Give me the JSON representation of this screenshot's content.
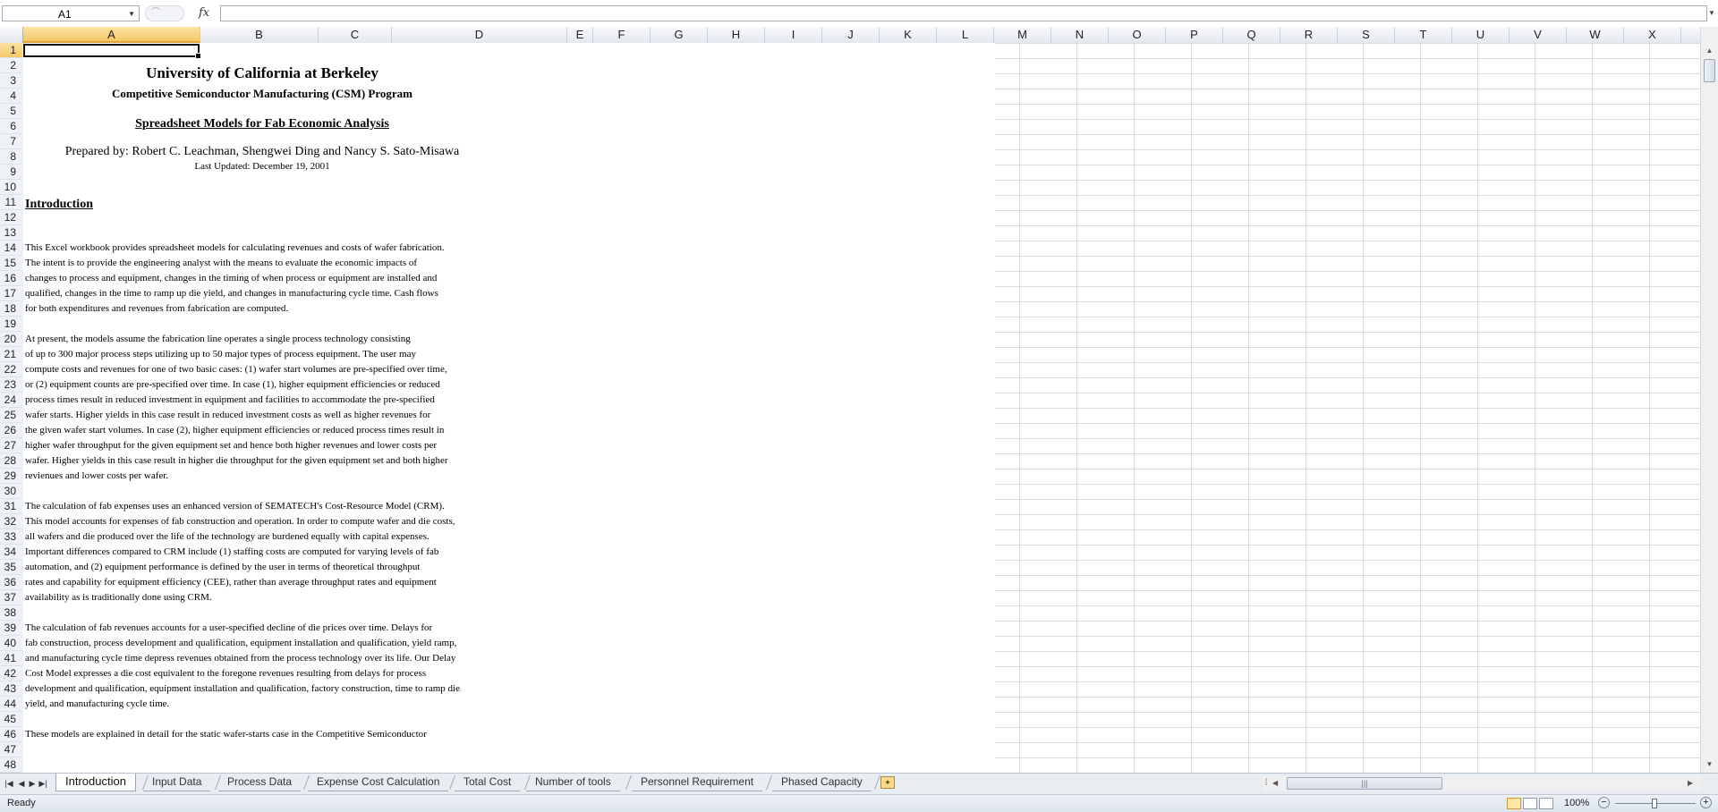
{
  "formula_bar": {
    "name_box": "A1",
    "fx_label": "fx",
    "formula_value": ""
  },
  "columns": [
    "A",
    "B",
    "C",
    "D",
    "E",
    "F",
    "G",
    "H",
    "I",
    "J",
    "K",
    "L",
    "M",
    "N",
    "O",
    "P",
    "Q",
    "R",
    "S",
    "T",
    "U",
    "V",
    "W",
    "X"
  ],
  "rows": [
    "1",
    "2",
    "3",
    "4",
    "5",
    "6",
    "7",
    "8",
    "9",
    "10",
    "11",
    "12",
    "13",
    "14",
    "15",
    "16",
    "17",
    "18",
    "19",
    "20",
    "21",
    "22",
    "23",
    "24",
    "25",
    "26",
    "27",
    "28",
    "29",
    "30",
    "31",
    "32",
    "33",
    "34",
    "35",
    "36",
    "37",
    "38",
    "39",
    "40",
    "41",
    "42",
    "43",
    "44",
    "45",
    "46",
    "47",
    "48"
  ],
  "cells": {
    "title": "University of California at Berkeley",
    "program": "Competitive Semiconductor Manufacturing (CSM) Program",
    "subtitle": "Spreadsheet Models for Fab Economic Analysis",
    "prepared_by": "Prepared by: Robert C. Leachman, Shengwei Ding and Nancy S. Sato-Misawa",
    "last_updated": "Last Updated: December 19, 2001",
    "heading": "Introduction",
    "lines": {
      "r14": "       This Excel workbook provides spreadsheet models for calculating revenues and costs of wafer fabrication.",
      "r15": "The intent is to provide the engineering analyst with the means to evaluate the economic impacts of",
      "r16": "changes to process and equipment, changes in the timing of when process or equipment are installed and",
      "r17": "qualified, changes in the time to ramp up die yield, and changes in manufacturing cycle time. Cash flows",
      "r18": "for both expenditures and revenues from fabrication are computed.",
      "r20": "       At present, the models assume the fabrication line operates a single process technology consisting",
      "r21": "of up to 300 major process steps utilizing up to 50 major types of process equipment. The user may",
      "r22": "compute costs and revenues for one of two basic cases: (1) wafer start volumes are pre-specified over time,",
      "r23": "or (2) equipment counts are pre-specified over time. In case (1), higher equipment efficiencies or reduced",
      "r24": "process times result in reduced investment in equipment and facilities to accommodate the pre-specified",
      "r25": "wafer starts. Higher yields in this case result in reduced investment costs as well as higher revenues for",
      "r26": "the given wafer start volumes. In case (2), higher equipment efficiencies or reduced process times result in",
      "r27": "higher wafer throughput for the given equipment set and hence both higher revenues and lower costs per",
      "r28": "wafer. Higher yields in this case result in higher die throughput for the given equipment set and both higher",
      "r29": "revienues and lower costs per wafer.",
      "r31": "        The calculation of fab expenses uses an enhanced version of SEMATECH's Cost-Resource Model (CRM).",
      "r32": "This model accounts for expenses of fab construction and operation. In order to compute wafer and die costs,",
      "r33": "all wafers and die produced over the life of the technology are burdened equally with capital expenses.",
      "r34": "Important differences compared to CRM include (1) staffing costs are computed for varying levels of fab",
      "r35": "automation, and (2) equipment performance is defined by the user in terms of theoretical throughput",
      "r36": "rates and capability for equipment efficiency (CEE), rather than average throughput rates and equipment",
      "r37": "availability as is traditionally done using CRM.",
      "r39": "       The calculation of fab revenues accounts for a user-specified decline of die prices over time. Delays for",
      "r40": "fab construction, process development and qualification, equipment installation and qualification, yield ramp,",
      "r41": "and manufacturing cycle time depress revenues obtained from the process technology over its life. Our Delay",
      "r42": "Cost Model expresses a die cost equivalent to the foregone revenues resulting from delays for process",
      "r43": "development and qualification, equipment installation and qualification, factory construction, time to ramp die",
      "r44": "yield, and manufacturing cycle time.",
      "r46": "       These models are explained in detail for the static wafer-starts case in the Competitive Semiconductor"
    }
  },
  "sheet_tabs": [
    "Introduction",
    "Input Data",
    "Process Data",
    "Expense Cost Calculation",
    "Total Cost",
    "Number of tools",
    "Personnel Requirement",
    "Phased Capacity"
  ],
  "active_tab": "Introduction",
  "status": {
    "text": "Ready",
    "zoom": "100%"
  },
  "icons": {
    "name_box_dropdown": "chevron-down-icon",
    "fx": "function-icon",
    "new_sheet": "new-sheet-icon",
    "view_normal": "normal-view-icon",
    "view_layout": "page-layout-icon",
    "view_break": "page-break-icon"
  },
  "colors": {
    "selection_header": "#f5c869",
    "grid_line": "#dadcdd",
    "header_border": "#9eb6ce"
  }
}
